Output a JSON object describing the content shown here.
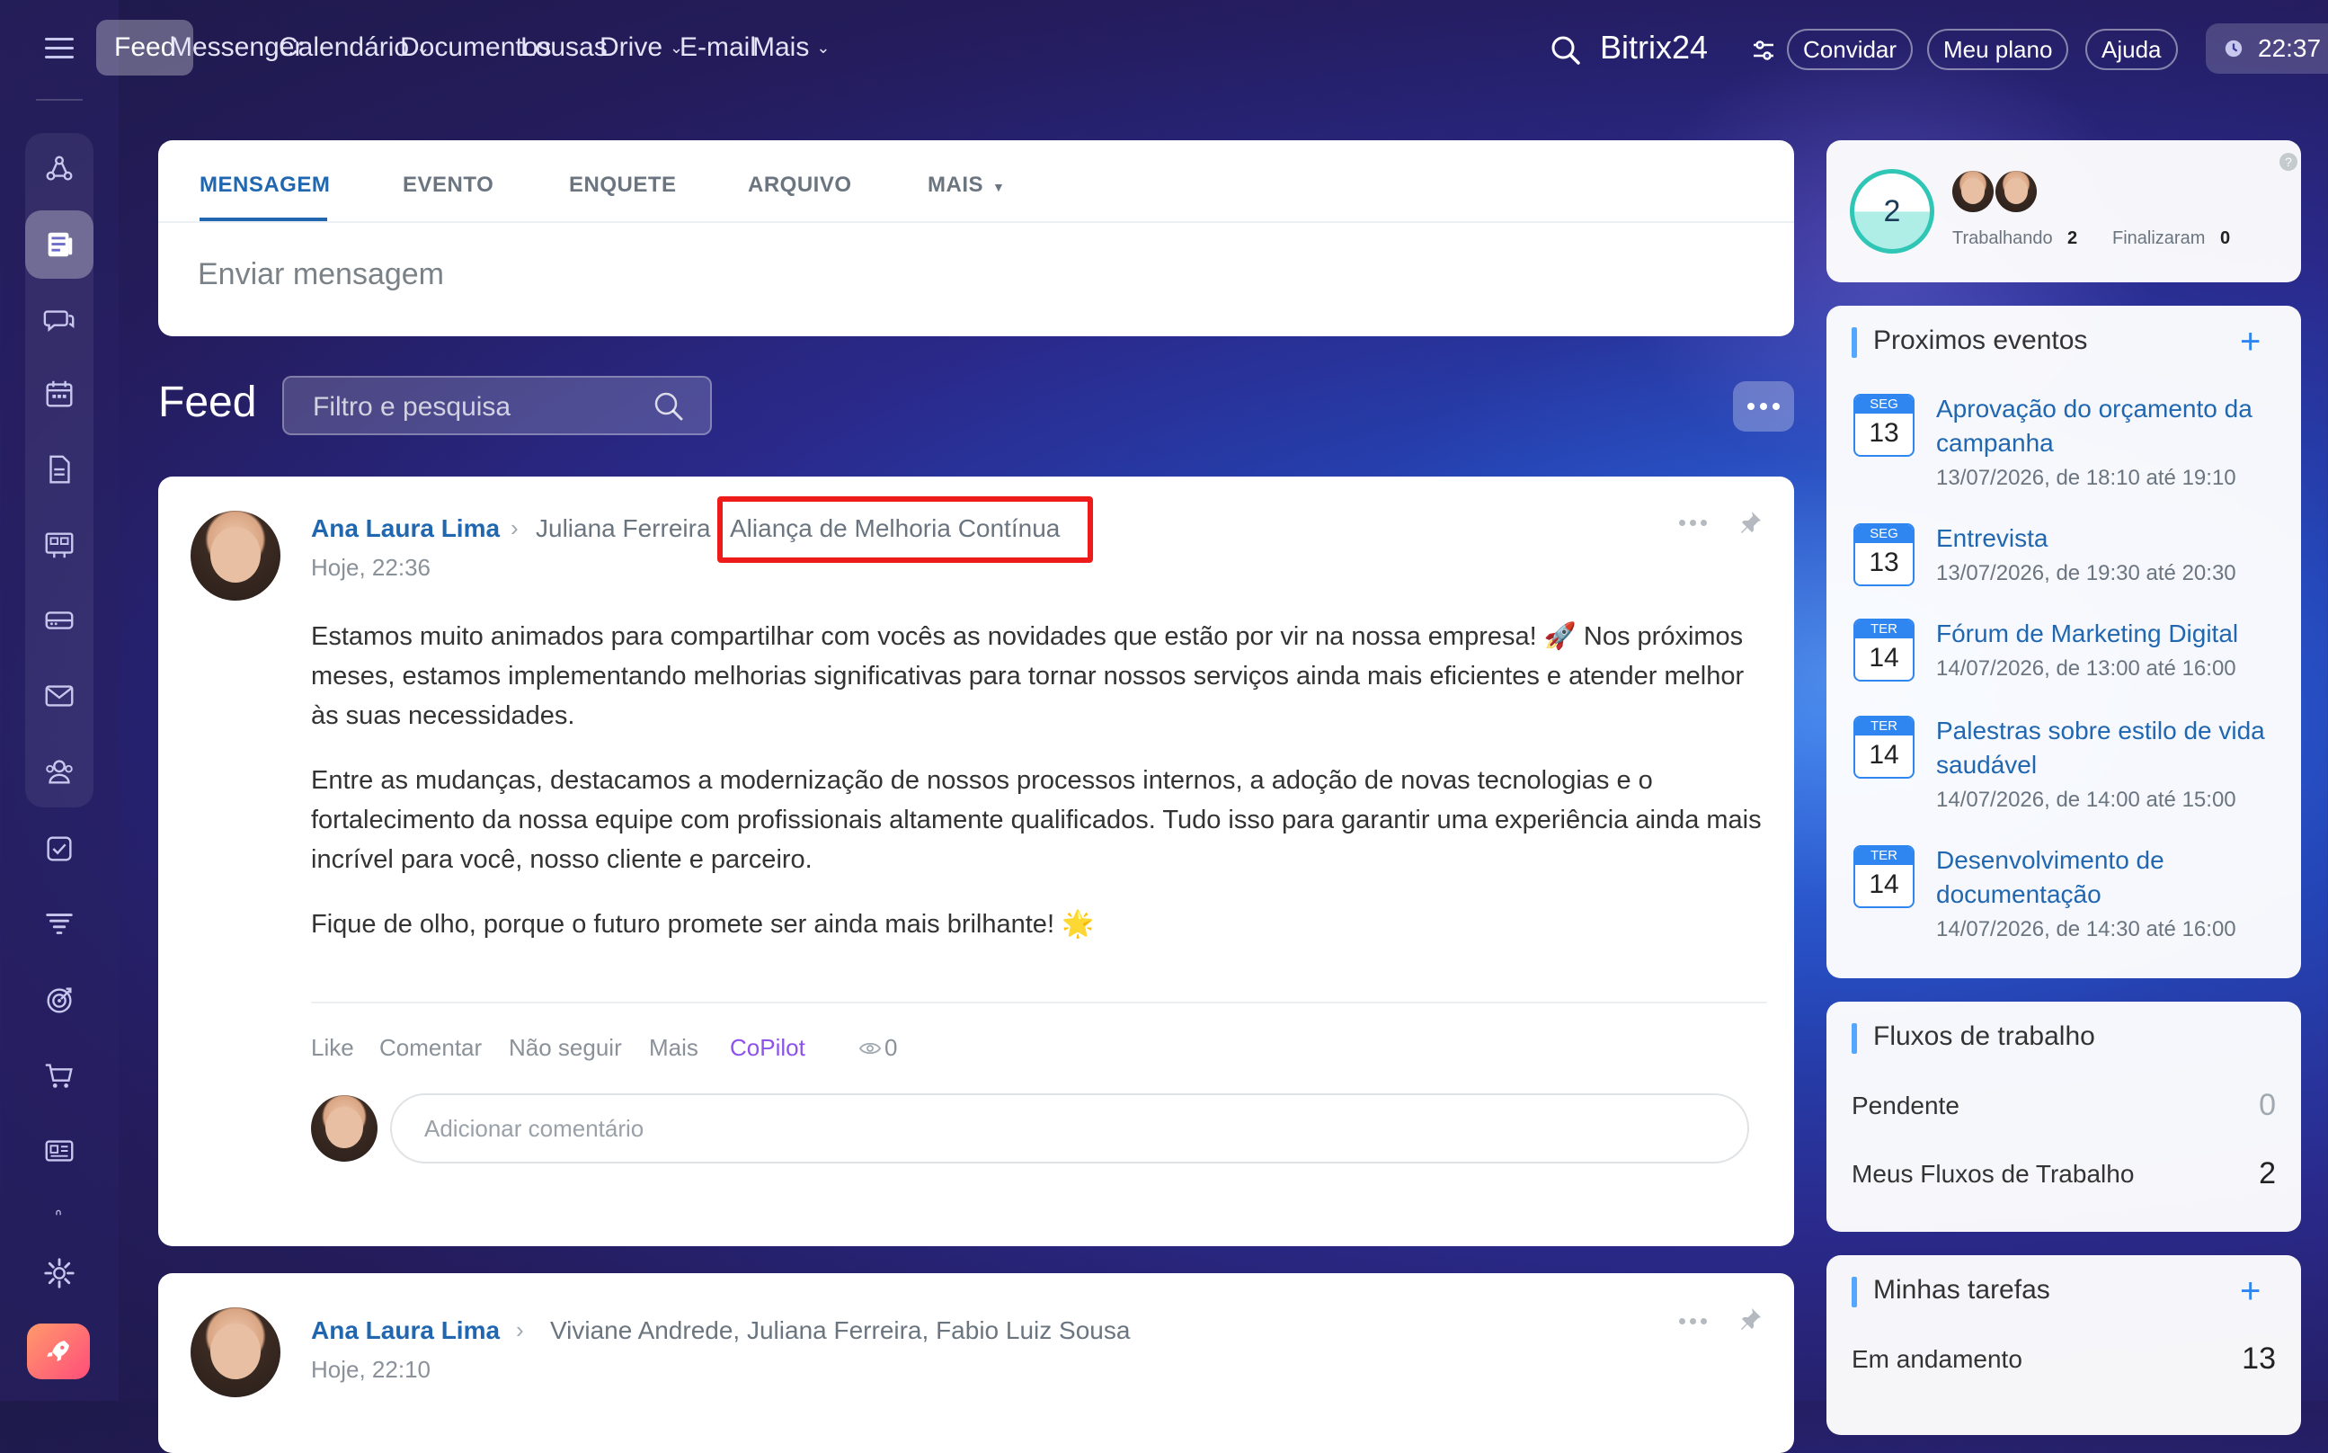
{
  "topnav": {
    "items": [
      {
        "label": "Feed",
        "active": true
      },
      {
        "label": "Messenger"
      },
      {
        "label": "Calendário",
        "dropdown": true
      },
      {
        "label": "Documentos"
      },
      {
        "label": "Lousas"
      },
      {
        "label": "Drive",
        "dropdown": true
      },
      {
        "label": "E-mail"
      },
      {
        "label": "Mais",
        "dropdown": true
      }
    ],
    "brand": "Bitrix24",
    "invite": "Convidar",
    "plan": "Meu plano",
    "help": "Ajuda",
    "clock": "22:37"
  },
  "composer": {
    "tabs": [
      "MENSAGEM",
      "EVENTO",
      "ENQUETE",
      "ARQUIVO",
      "MAIS"
    ],
    "placeholder": "Enviar mensagem"
  },
  "feed": {
    "title": "Feed",
    "search_placeholder": "Filtro e pesquisa"
  },
  "post1": {
    "author": "Ana Laura Lima",
    "recipient": "Juliana Ferreira",
    "group": "Aliança de Melhoria Contínua",
    "time": "Hoje, 22:36",
    "paragraphs": [
      "Estamos muito animados para compartilhar com vocês as novidades que estão por vir na nossa empresa! 🚀 Nos próximos meses, estamos implementando melhorias significativas para tornar nossos serviços ainda mais eficientes e atender melhor às suas necessidades.",
      "Entre as mudanças, destacamos a modernização de nossos processos internos, a adoção de novas tecnologias e o fortalecimento da nossa equipe com profissionais altamente qualificados. Tudo isso para garantir uma experiência ainda mais incrível para você, nosso cliente e parceiro.",
      "Fique de olho, porque o futuro promete ser ainda mais brilhante! 🌟"
    ],
    "actions": {
      "like": "Like",
      "comment": "Comentar",
      "unfollow": "Não seguir",
      "more": "Mais",
      "copilot": "CoPilot",
      "views": "0"
    },
    "comment_placeholder": "Adicionar comentário"
  },
  "post2": {
    "author": "Ana Laura Lima",
    "recipients": "Viviane Andrede, Juliana Ferreira, Fabio Luiz Sousa",
    "time": "Hoje, 22:10"
  },
  "worktime": {
    "count": "2",
    "working_label": "Trabalhando",
    "working": "2",
    "finished_label": "Finalizaram",
    "finished": "0",
    "help": "?"
  },
  "events": {
    "title": "Proximos eventos",
    "plus": "+",
    "items": [
      {
        "dow": "SEG",
        "day": "13",
        "title": "Aprovação do orçamento da campanha",
        "time": "13/07/2026, de 18:10 até 19:10"
      },
      {
        "dow": "SEG",
        "day": "13",
        "title": "Entrevista",
        "time": "13/07/2026, de 19:30 até 20:30"
      },
      {
        "dow": "TER",
        "day": "14",
        "title": "Fórum de Marketing Digital",
        "time": "14/07/2026, de 13:00 até 16:00"
      },
      {
        "dow": "TER",
        "day": "14",
        "title": "Palestras sobre estilo de vida saudável",
        "time": "14/07/2026, de 14:00 até 15:00"
      },
      {
        "dow": "TER",
        "day": "14",
        "title": "Desenvolvimento de documentação",
        "time": "14/07/2026, de 14:30 até 16:00"
      }
    ]
  },
  "flows": {
    "title": "Fluxos de trabalho",
    "pending_label": "Pendente",
    "pending": "0",
    "mine_label": "Meus Fluxos de Trabalho",
    "mine": "2"
  },
  "tasks": {
    "title": "Minhas tarefas",
    "plus": "+",
    "inprogress_label": "Em andamento",
    "inprogress": "13"
  },
  "colors": {
    "accent": "#2067b0",
    "highlight": "#ee1b1b",
    "copilot": "#8e52ec"
  }
}
